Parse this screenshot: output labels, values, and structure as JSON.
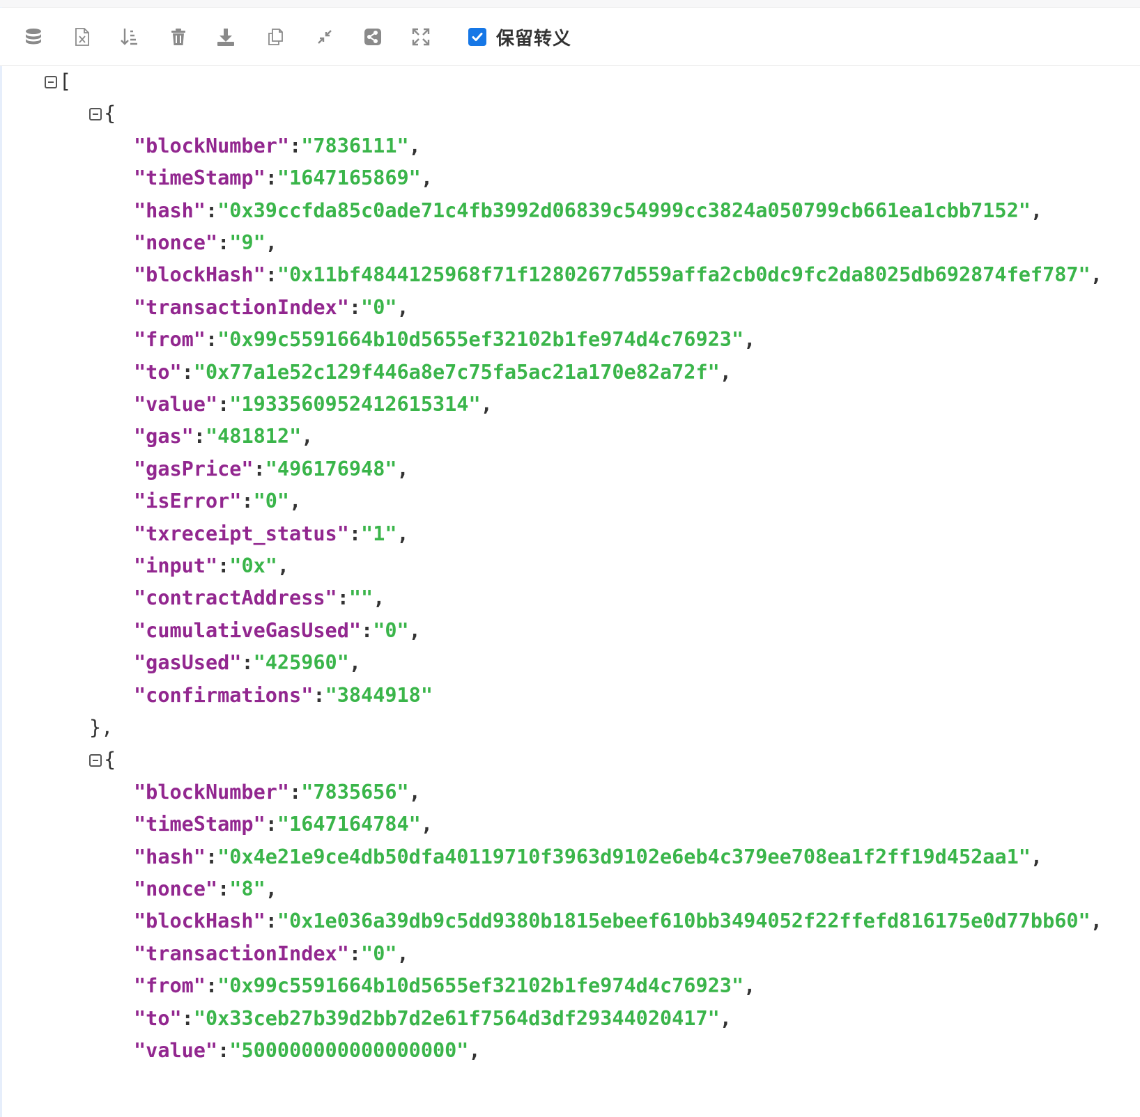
{
  "toolbar": {
    "icons": [
      "database-icon",
      "excel-export-icon",
      "sort-icon",
      "delete-icon",
      "download-icon",
      "copy-icon",
      "collapse-icon",
      "share-icon",
      "expand-icon"
    ],
    "escape_checkbox_checked": true,
    "escape_label": "保留转义",
    "accent_color": "#1677e6"
  },
  "json": {
    "colors": {
      "key": "#92278f",
      "string": "#3ab54a",
      "punct": "#333333"
    },
    "open_array": "[",
    "open_object": "{",
    "close_object": "},",
    "records": [
      {
        "fields": [
          [
            "blockNumber",
            "7836111"
          ],
          [
            "timeStamp",
            "1647165869"
          ],
          [
            "hash",
            "0x39ccfda85c0ade71c4fb3992d06839c54999cc3824a050799cb661ea1cbb7152"
          ],
          [
            "nonce",
            "9"
          ],
          [
            "blockHash",
            "0x11bf4844125968f71f12802677d559affa2cb0dc9fc2da8025db692874fef787"
          ],
          [
            "transactionIndex",
            "0"
          ],
          [
            "from",
            "0x99c5591664b10d5655ef32102b1fe974d4c76923"
          ],
          [
            "to",
            "0x77a1e52c129f446a8e7c75fa5ac21a170e82a72f"
          ],
          [
            "value",
            "1933560952412615314"
          ],
          [
            "gas",
            "481812"
          ],
          [
            "gasPrice",
            "496176948"
          ],
          [
            "isError",
            "0"
          ],
          [
            "txreceipt_status",
            "1"
          ],
          [
            "input",
            "0x"
          ],
          [
            "contractAddress",
            ""
          ],
          [
            "cumulativeGasUsed",
            "0"
          ],
          [
            "gasUsed",
            "425960"
          ],
          [
            "confirmations",
            "3844918"
          ]
        ]
      },
      {
        "fields": [
          [
            "blockNumber",
            "7835656"
          ],
          [
            "timeStamp",
            "1647164784"
          ],
          [
            "hash",
            "0x4e21e9ce4db50dfa40119710f3963d9102e6eb4c379ee708ea1f2ff19d452aa1"
          ],
          [
            "nonce",
            "8"
          ],
          [
            "blockHash",
            "0x1e036a39db9c5dd9380b1815ebeef610bb3494052f22ffefd816175e0d77bb60"
          ],
          [
            "transactionIndex",
            "0"
          ],
          [
            "from",
            "0x99c5591664b10d5655ef32102b1fe974d4c76923"
          ],
          [
            "to",
            "0x33ceb27b39d2bb7d2e61f7564d3df29344020417"
          ],
          [
            "value",
            "500000000000000000"
          ]
        ]
      }
    ]
  }
}
